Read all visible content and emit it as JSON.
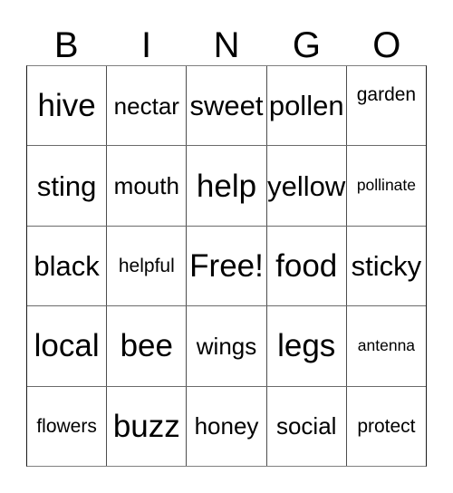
{
  "card": {
    "title_letters": [
      "B",
      "I",
      "N",
      "G",
      "O"
    ],
    "free_space_text": "Free!",
    "free_space_position": {
      "row": 2,
      "col": 2
    },
    "grid_size": {
      "rows": 5,
      "cols": 5
    },
    "colors": {
      "background": "#ffffff",
      "text": "#000000",
      "grid_line": "#4d4d4d",
      "grid_outer": "#1a1a1a"
    }
  },
  "rows": [
    {
      "cells": [
        {
          "text": "hive",
          "size": "sz-xl"
        },
        {
          "text": "nectar",
          "size": "sz-md"
        },
        {
          "text": "sweet",
          "size": "sz-lg"
        },
        {
          "text": "pollen",
          "size": "sz-lg"
        },
        {
          "text": "garden",
          "size": "sz-sm"
        }
      ]
    },
    {
      "cells": [
        {
          "text": "sting",
          "size": "sz-lg"
        },
        {
          "text": "mouth",
          "size": "sz-md"
        },
        {
          "text": "help",
          "size": "sz-xl"
        },
        {
          "text": "yellow",
          "size": "sz-lg"
        },
        {
          "text": "pollinate",
          "size": "sz-xs"
        }
      ]
    },
    {
      "cells": [
        {
          "text": "black",
          "size": "sz-lg"
        },
        {
          "text": "helpful",
          "size": "sz-sm"
        },
        {
          "text": "Free!",
          "size": "sz-xl"
        },
        {
          "text": "food",
          "size": "sz-xl"
        },
        {
          "text": "sticky",
          "size": "sz-lg"
        }
      ]
    },
    {
      "cells": [
        {
          "text": "local",
          "size": "sz-xl"
        },
        {
          "text": "bee",
          "size": "sz-xl"
        },
        {
          "text": "wings",
          "size": "sz-md"
        },
        {
          "text": "legs",
          "size": "sz-xl"
        },
        {
          "text": "antenna",
          "size": "sz-xs"
        }
      ]
    },
    {
      "cells": [
        {
          "text": "flowers",
          "size": "sz-sm"
        },
        {
          "text": "buzz",
          "size": "sz-xl"
        },
        {
          "text": "honey",
          "size": "sz-md"
        },
        {
          "text": "social",
          "size": "sz-md"
        },
        {
          "text": "protect",
          "size": "sz-sm"
        }
      ]
    }
  ]
}
